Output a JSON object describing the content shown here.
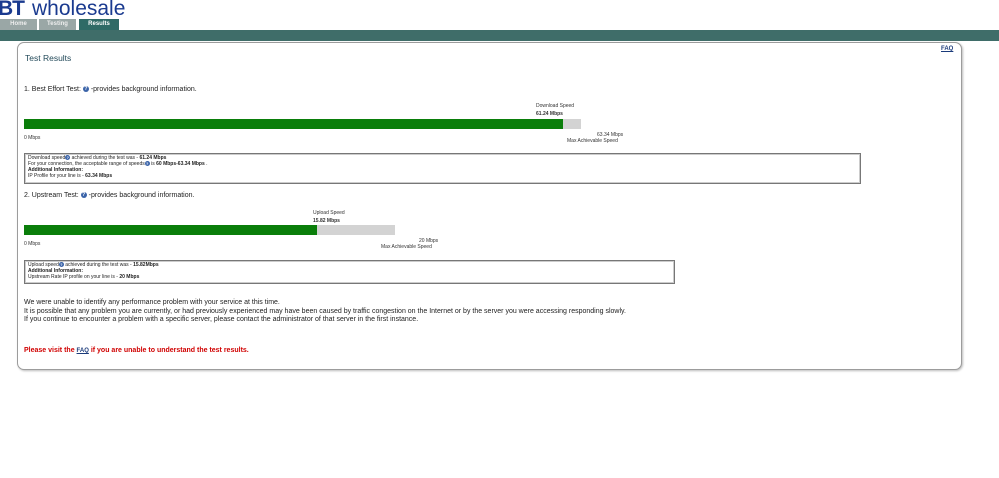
{
  "logo": {
    "bt": "BT",
    "wholesale": "wholesale"
  },
  "tabs": [
    {
      "label": "Home",
      "active": false
    },
    {
      "label": "Testing",
      "active": false
    },
    {
      "label": "Results",
      "active": true
    }
  ],
  "faq_top": "FAQ",
  "title": "Test Results",
  "download": {
    "heading_pre": "1. Best Effort Test:",
    "heading_post": " -provides background information.",
    "speed_label": "Download Speed",
    "speed_value": "61.24 Mbps",
    "fraction": 0.9675,
    "min_label": "0 Mbps",
    "max_value": "63.34 Mbps",
    "max_label": "Max Achievable Speed",
    "info": {
      "line1_pre": "Download speed",
      "line1_mid": " achieved during the test was - ",
      "line1_val": "61.24 Mbps",
      "line2_pre": "For your connection, the acceptable range of speeds",
      "line2_mid": " is ",
      "line2_val": "60 Mbps-63.34 Mbps",
      "line2_end": " .",
      "line3": "Additional Information:",
      "line4_pre": "IP Profile for your line is - ",
      "line4_val": "63.34 Mbps"
    }
  },
  "upload": {
    "heading_pre": "2. Upstream Test:",
    "heading_post": " -provides background information.",
    "speed_label": "Upload Speed",
    "speed_value": "15.82 Mbps",
    "fraction": 0.791,
    "min_label": "0 Mbps",
    "max_value": "20 Mbps",
    "max_label": "Max Achievable Speed",
    "info": {
      "line1_pre": "Upload speed",
      "line1_mid": " achieved during the test was - ",
      "line1_val": "15.82Mbps",
      "line2": "Additional Information:",
      "line3_pre": "Upstream Rate IP profile on your line is - ",
      "line3_val": "20 Mbps"
    }
  },
  "message": {
    "line1": "We were unable to identify any performance problem with your service at this time.",
    "line2": "It is possible that any problem you are currently, or had previously experienced may have been caused by traffic congestion on the Internet or by the server you were accessing responding slowly.",
    "line3": "If you continue to encounter a problem with a specific server, please contact the administrator of that server in the first instance."
  },
  "notice": {
    "pre": "Please visit the ",
    "link": "FAQ",
    "post": " if you are unable to understand the test results."
  }
}
